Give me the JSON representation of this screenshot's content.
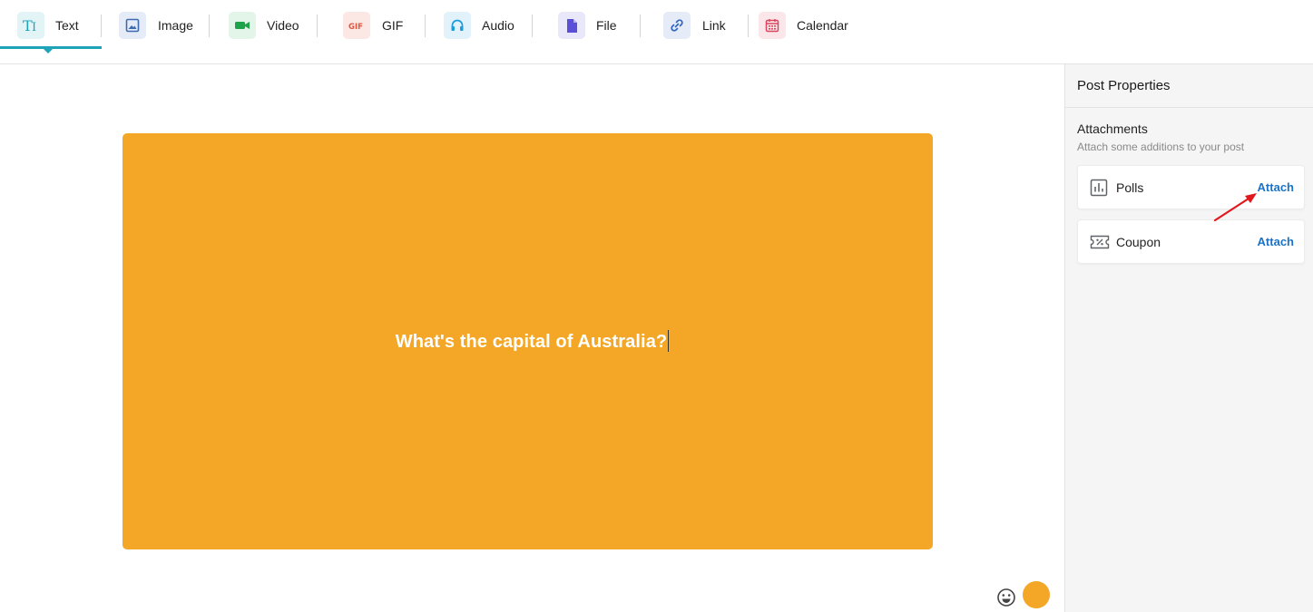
{
  "toolbar": {
    "tabs": [
      {
        "label": "Text",
        "icon": "text-format-icon",
        "active": true
      },
      {
        "label": "Image",
        "icon": "image-icon"
      },
      {
        "label": "Video",
        "icon": "video-camera-icon"
      },
      {
        "label": "GIF",
        "icon": "gif-icon"
      },
      {
        "label": "Audio",
        "icon": "headphones-icon"
      },
      {
        "label": "File",
        "icon": "file-icon"
      },
      {
        "label": "Link",
        "icon": "link-icon"
      },
      {
        "label": "Calendar",
        "icon": "calendar-icon"
      }
    ],
    "active_color": "#1fa3b8"
  },
  "editor": {
    "text": "What's the capital of Australia?",
    "background_color": "#f4a726",
    "text_color": "#ffffff"
  },
  "panel": {
    "title": "Post Properties",
    "attachments": {
      "title": "Attachments",
      "subtitle": "Attach some additions to your post",
      "items": [
        {
          "name": "Polls",
          "icon": "poll-chart-icon",
          "action": "Attach"
        },
        {
          "name": "Coupon",
          "icon": "coupon-ticket-icon",
          "action": "Attach"
        }
      ]
    },
    "link_color": "#1a73c8"
  }
}
